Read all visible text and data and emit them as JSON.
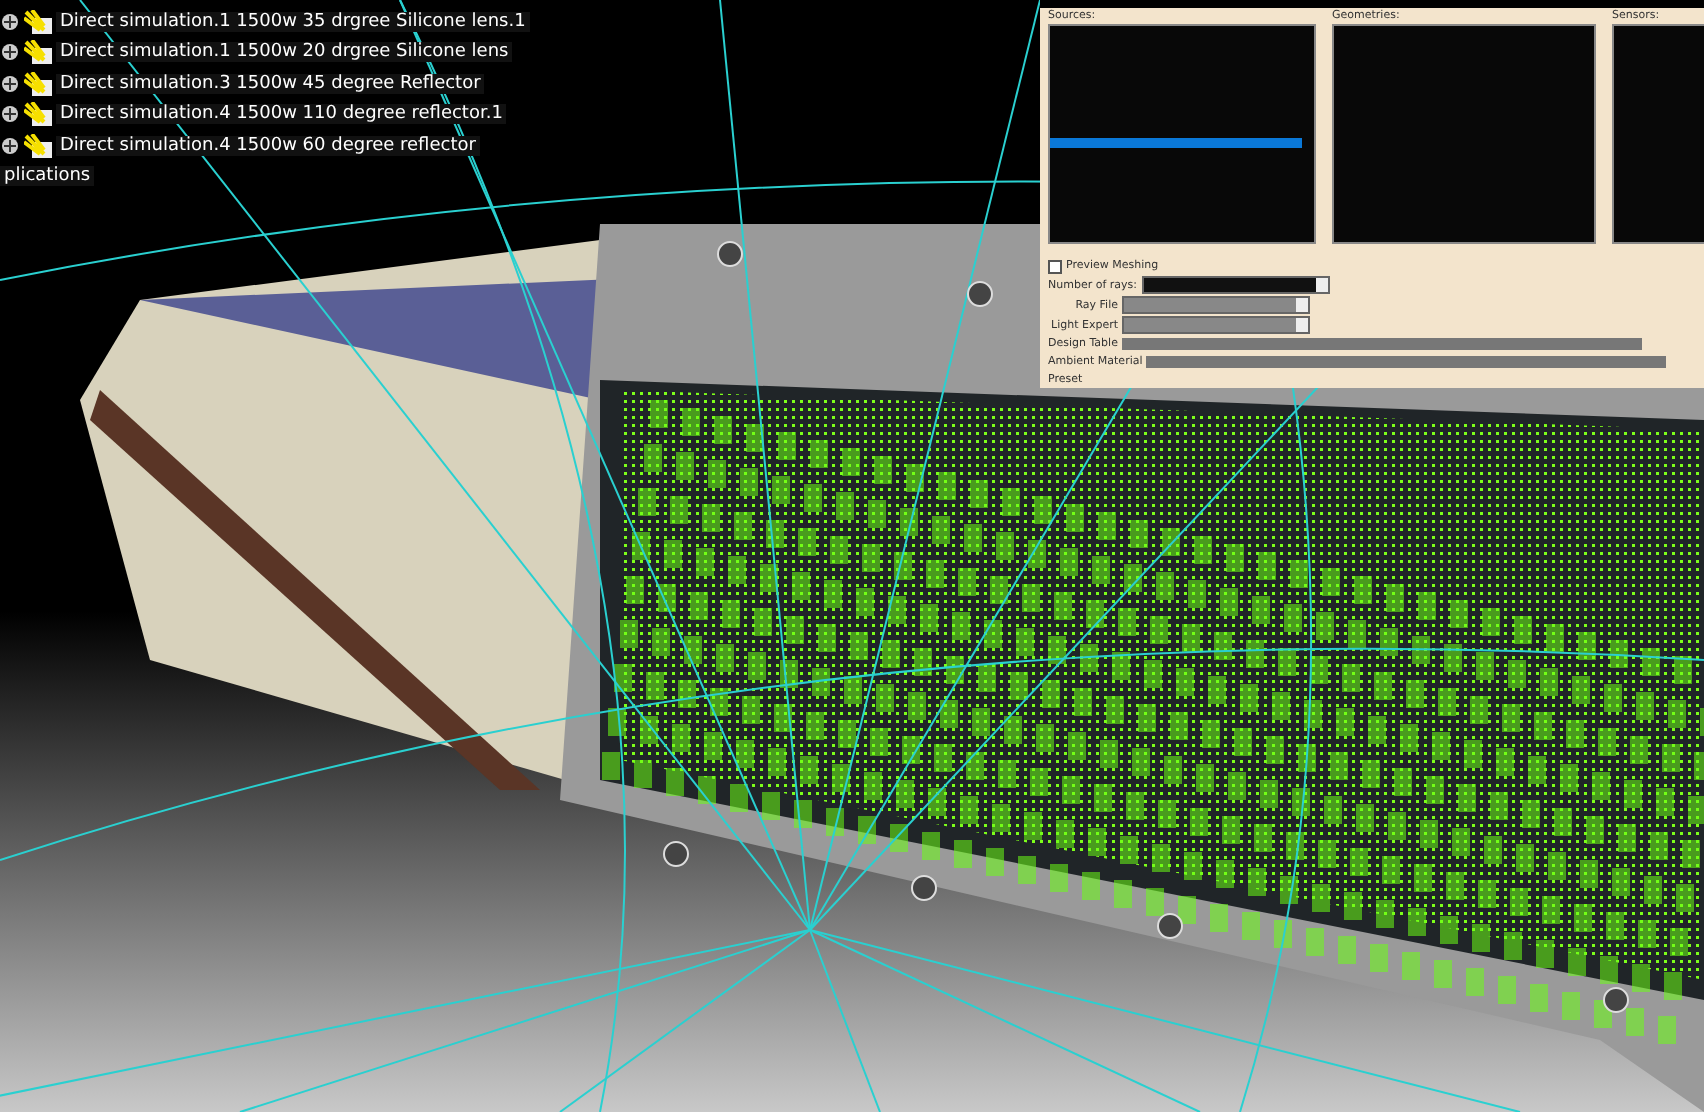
{
  "tree": {
    "items": [
      {
        "label": "Direct simulation.1 1500w 35 drgree Silicone lens.1"
      },
      {
        "label": "Direct simulation.1 1500w 20 drgree Silicone lens"
      },
      {
        "label": "Direct simulation.3 1500w 45 degree Reflector"
      },
      {
        "label": "Direct simulation.4 1500w 110 degree reflector.1"
      },
      {
        "label": "Direct simulation.4 1500w 60 degree reflector"
      }
    ],
    "footer": "plications"
  },
  "dialog": {
    "lists": [
      {
        "label": "Sources:"
      },
      {
        "label": "Geometries:"
      },
      {
        "label": "Sensors:"
      }
    ],
    "preview_meshing": {
      "label": "Preview Meshing",
      "checked": false
    },
    "fields": [
      {
        "label": "Number of rays:",
        "kind": "spin"
      },
      {
        "label": "Ray File",
        "kind": "combo"
      },
      {
        "label": "Light Expert",
        "kind": "combo"
      }
    ],
    "rows": [
      {
        "label": "Design Table"
      },
      {
        "label": "Ambient Material"
      },
      {
        "label": "Preset"
      }
    ]
  }
}
